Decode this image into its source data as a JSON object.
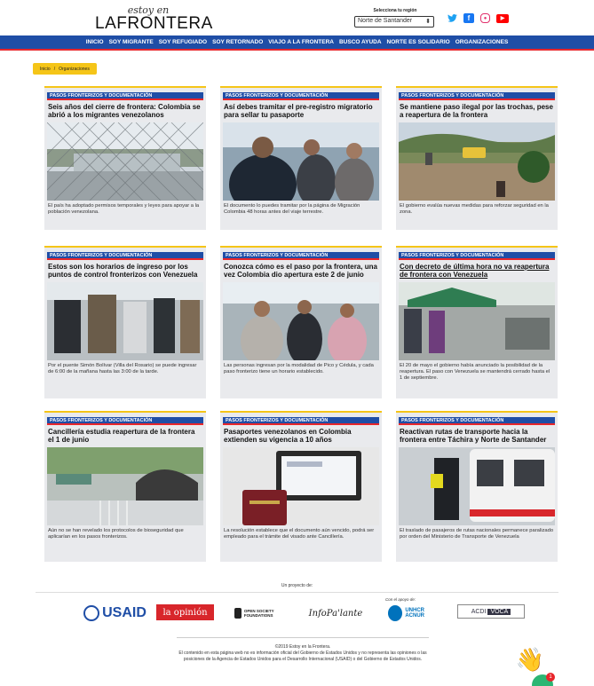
{
  "header": {
    "logo_top": "estoy en",
    "logo_main": "LAFRONTERA",
    "region_label": "Selecciona tu región",
    "region_value": "Norte de Santander",
    "social": [
      "twitter-icon",
      "facebook-icon",
      "instagram-icon",
      "youtube-icon"
    ]
  },
  "nav": [
    "INICIO",
    "SOY MIGRANTE",
    "SOY REFUGIADO",
    "SOY RETORNADO",
    "VIAJO A LA FRONTERA",
    "BUSCO AYUDA",
    "NORTE ES SOLIDARIO",
    "ORGANIZACIONES"
  ],
  "breadcrumb": {
    "home": "Inicio",
    "sep": "/",
    "current": "Organizaciones"
  },
  "cards": [
    {
      "category": "PASOS FRONTERIZOS Y DOCUMENTACIÓN",
      "title": "Seis años del cierre de frontera: Colombia se abrió a los migrantes venezolanos",
      "description": "El país ha adoptado permisos temporales y leyes para apoyar a la población venezolana."
    },
    {
      "category": "PASOS FRONTERIZOS Y DOCUMENTACIÓN",
      "title": "Así debes tramitar el pre-registro migratorio para sellar tu pasaporte",
      "description": "El documento lo puedes tramitar por la página de Migración Colombia 48 horas antes del viaje terrestre."
    },
    {
      "category": "PASOS FRONTERIZOS Y DOCUMENTACIÓN",
      "title": "Se mantiene paso ilegal por las trochas, pese a reapertura de la frontera",
      "description": "El gobierno evalúa nuevas medidas para reforzar seguridad en la zona."
    },
    {
      "category": "PASOS FRONTERIZOS Y DOCUMENTACIÓN",
      "title": "Estos son los horarios de ingreso por los puntos de control fronterizos con Venezuela",
      "description": "Por el puente Simón Bolívar (Villa del Rosario) se puede ingresar de 6:00 de la mañana hasta las 3:00 de la tarde."
    },
    {
      "category": "PASOS FRONTERIZOS Y DOCUMENTACIÓN",
      "title": "Conozca cómo es el paso por la frontera, una vez Colombia dio apertura este 2 de junio",
      "description": "Las personas ingresan por la modalidad de Pico y Cédula, y cada paso fronterizo tiene un horario establecido."
    },
    {
      "category": "PASOS FRONTERIZOS Y DOCUMENTACIÓN",
      "title": "Con decreto de última hora no va reapertura de frontera con Venezuela",
      "description": "El 20 de mayo el gobierno había anunciado la posibilidad de la reapertura. El paso con Venezuela se mantendrá cerrado hasta el 1 de septiembre."
    },
    {
      "category": "PASOS FRONTERIZOS Y DOCUMENTACIÓN",
      "title": "Cancillería estudia reapertura de la frontera el 1 de junio",
      "description": "Aún no se han revelado los protocolos de bioseguridad que aplicarían en los pasos fronterizos."
    },
    {
      "category": "PASOS FRONTERIZOS Y DOCUMENTACIÓN",
      "title": "Pasaportes venezolanos en Colombia extienden su vigencia a 10 años",
      "description": "La resolución establece que el documento aún vencido, podrá ser empleado para el trámite del visado ante Cancillería."
    },
    {
      "category": "PASOS FRONTERIZOS Y DOCUMENTACIÓN",
      "title": "Reactivan rutas de transporte hacia la frontera entre Táchira y Norte de Santander",
      "description": "El traslado de pasajeros de rutas nacionales permanece paralizado por orden del Ministerio de Transporte de Venezuela"
    }
  ],
  "footer": {
    "proyecto": "Un proyecto de:",
    "apoyo": "Con el apoyo de:",
    "logos": {
      "usaid": "USAID",
      "opinion": "la opinión",
      "osf": "OPEN SOCIETY FOUNDATIONS",
      "infopalante": "InfoPa'lante",
      "unhcr": "UNHCR ACNUR",
      "acdi": "ACDI",
      "voca": "VOCA"
    },
    "copyright": "©2019 Estoy en la Frontera.",
    "disclaimer": "El contenido en esta página web no es información oficial del Gobierno de Estados Unidos y no representa las opiniones o las posiciones de la Agencia de Estados Unidos para el Desarrollo Internacional (USAID) o del Gobierno de Estados Unidos.",
    "chat_badge": "1"
  },
  "colors": {
    "nav_blue": "#1f4ea6",
    "accent_red": "#e8262b",
    "accent_yellow": "#f5c518",
    "card_bg": "#e9eaed"
  }
}
